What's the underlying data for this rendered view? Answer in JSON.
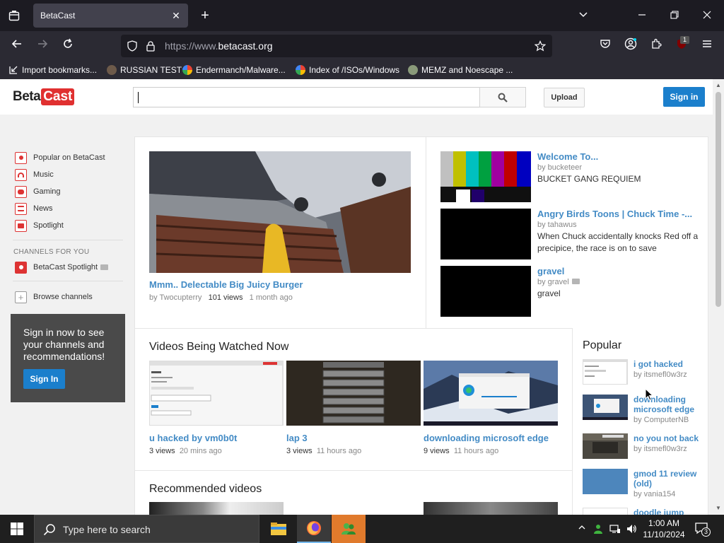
{
  "browser": {
    "tab_title": "BetaCast",
    "url_protocol": "https://www.",
    "url_domain": "betacast.org",
    "extension_badge": "1",
    "bookmarks": [
      {
        "label": "Import bookmarks...",
        "icon": "import-icon"
      },
      {
        "label": "RUSSIAN TEST",
        "icon": "site-icon"
      },
      {
        "label": "Endermanch/Malware...",
        "icon": "google-icon"
      },
      {
        "label": "Index of /ISOs/Windows",
        "icon": "google-icon"
      },
      {
        "label": "MEMZ and Noescape ...",
        "icon": "site-icon"
      }
    ]
  },
  "site": {
    "logo_left": "Beta",
    "logo_right": "Cast",
    "search_placeholder": "",
    "upload_label": "Upload",
    "signin_label": "Sign in"
  },
  "guide": {
    "items": [
      {
        "label": "Popular on BetaCast"
      },
      {
        "label": "Music"
      },
      {
        "label": "Gaming"
      },
      {
        "label": "News"
      },
      {
        "label": "Spotlight"
      }
    ],
    "channels_heading": "CHANNELS FOR YOU",
    "channel_item": "BetaCast Spotlight",
    "browse_label": "Browse channels",
    "promo_text": "Sign in now to see your channels and recommendations!",
    "promo_button": "Sign In"
  },
  "featured": {
    "title": "Mmm.. Delectable Big Juicy Burger",
    "by_prefix": "by",
    "author": "Twocupterry",
    "views": "101 views",
    "age": "1 month ago"
  },
  "side_videos": [
    {
      "title": "Welcome To...",
      "by": "by bucketeer",
      "desc": "BUCKET GANG REQUIEM"
    },
    {
      "title": "Angry Birds Toons | Chuck Time -...",
      "by": "by tahawus",
      "desc": "When Chuck accidentally knocks Red off a precipice, the race is on to save"
    },
    {
      "title": "gravel",
      "by": "by gravel",
      "desc": "gravel"
    }
  ],
  "watched_now": {
    "heading": "Videos Being Watched Now",
    "videos": [
      {
        "title": "u hacked by vm0b0t",
        "views": "3 views",
        "age": "20 mins ago"
      },
      {
        "title": "lap 3",
        "views": "3 views",
        "age": "11 hours ago"
      },
      {
        "title": "downloading microsoft edge",
        "views": "9 views",
        "age": "11 hours ago"
      }
    ]
  },
  "recommended_heading": "Recommended videos",
  "popular": {
    "heading": "Popular",
    "items": [
      {
        "title": "i got hacked",
        "by": "by itsmefl0w3rz"
      },
      {
        "title": "downloading microsoft edge",
        "by": "by ComputerNB"
      },
      {
        "title": "no you not back",
        "by": "by itsmefl0w3rz"
      },
      {
        "title": "gmod 11 review (old)",
        "by": "by vania154"
      },
      {
        "title": "doodle jump",
        "by": ""
      }
    ]
  },
  "taskbar": {
    "search_placeholder": "Type here to search",
    "time": "1:00 AM",
    "date": "11/10/2024",
    "notification_count": "3"
  },
  "colors": {
    "link_blue": "#438bc5",
    "brand_red": "#e03030",
    "button_blue": "#1b7fcc"
  }
}
